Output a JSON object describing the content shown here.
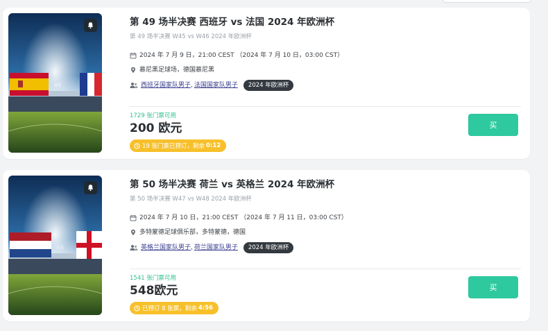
{
  "colors": {
    "accent": "#2ec99e",
    "availability": "#2fbf8f",
    "timer": "#f7c02b",
    "tag": "#33393f",
    "link": "#3a3f8f"
  },
  "events": [
    {
      "title": "第 49 场半决赛 西班牙 vs 法国 2024 年欧洲杯",
      "subtitle": "第 49 场半决赛 W45 vs W46 2024 年欧洲杯",
      "date": "2024 年 7 月 9 日，21:00 CEST （2024 年 7 月 10 日，03:00 CST）",
      "venue": "慕尼黑足球场，德国慕尼黑",
      "team1": "西班牙国家队男子",
      "team2": "法国国家队男子",
      "tag": "2024 年欧洲杯",
      "availability": "1729 张门票可用",
      "price": "200 欧元",
      "timer_text": "19 张门票已预订，剩余",
      "timer_time": "0:12",
      "buy_label": "买",
      "flag_left": "spain",
      "flag_right": "france"
    },
    {
      "title": "第 50 场半决赛 荷兰 vs 英格兰 2024 年欧洲杯",
      "subtitle": "第 50 场半决赛 W47 vs W48 2024 年欧洲杯",
      "date": "2024 年 7 月 10 日，21:00 CEST （2024 年 7 月 11 日，03:00 CST）",
      "venue": "多特蒙德足球俱乐部，多特蒙德，德国",
      "team1": "英格兰国家队男子",
      "team2": "荷兰国家队男子",
      "tag": "2024 年欧洲杯",
      "availability": "1541 张门票可用",
      "price": "548欧元",
      "timer_text": "已预订 8 张票，剩余",
      "timer_time": "4:56",
      "buy_label": "买",
      "flag_left": "netherlands",
      "flag_right": "england"
    }
  ]
}
